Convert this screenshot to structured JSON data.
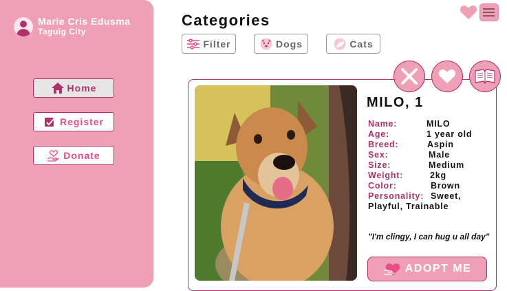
{
  "user": {
    "name": "Marie Cris Edusma",
    "city": "Taguig City"
  },
  "nav": {
    "home": "Home",
    "register": "Register",
    "donate": "Donate"
  },
  "page": {
    "title": "Categories"
  },
  "filters": {
    "filter": "Filter",
    "dogs": "Dogs",
    "cats": "Cats"
  },
  "pet": {
    "title": "MILO, 1",
    "fields": [
      {
        "label": "Name:",
        "value": "MILO"
      },
      {
        "label": "Age:",
        "value": "1 year old"
      },
      {
        "label": "Breed:",
        "value": "Aspin"
      },
      {
        "label": "Sex:",
        "value": "Male"
      },
      {
        "label": "Size:",
        "value": "Medium"
      },
      {
        "label": "Weight:",
        "value": "2kg"
      },
      {
        "label": "Color:",
        "value": "Brown"
      },
      {
        "label": "Personality:",
        "value": "Sweet,"
      }
    ],
    "personality_cont": "Playful, Trainable",
    "quote": "\"I'm clingy, I can hug u all day\"",
    "adopt_label": "ADOPT ME"
  },
  "colors": {
    "accent": "#b0306a",
    "pink": "#f0a0b6",
    "pink_text": "#e84b86"
  },
  "icons": [
    "user-icon",
    "home-icon",
    "register-icon",
    "donate-icon",
    "filter-icon",
    "dog-icon",
    "cat-icon",
    "heart-icon",
    "menu-icon",
    "close-icon",
    "book-icon",
    "adopt-heart-icon"
  ]
}
